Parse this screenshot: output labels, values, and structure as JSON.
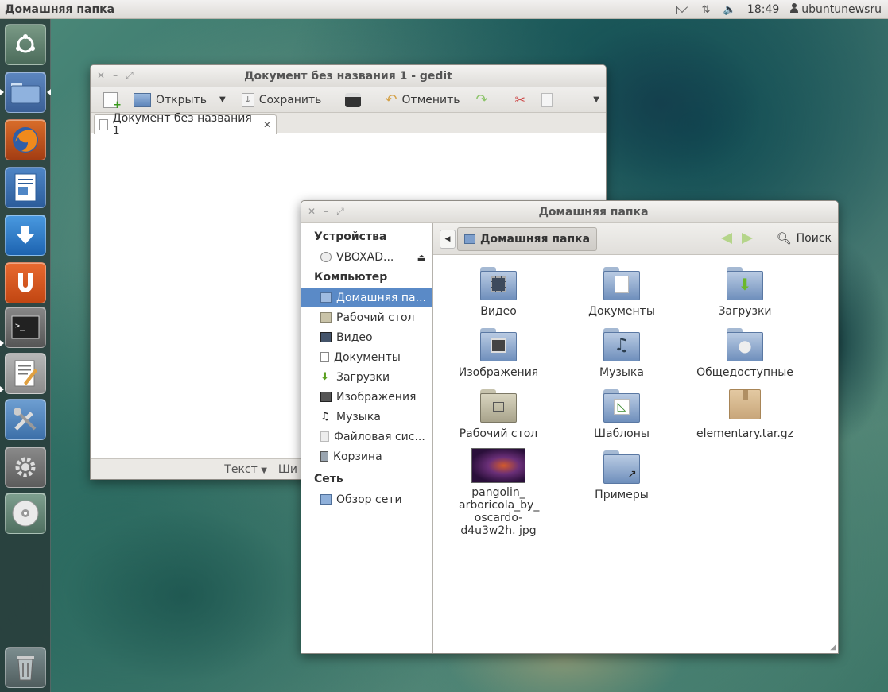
{
  "top_panel": {
    "title": "Домашняя папка",
    "clock": "18:49",
    "user": "ubuntunewsru"
  },
  "launcher": {
    "items": [
      "ubuntu-dash",
      "files",
      "firefox",
      "libreoffice-writer",
      "update-manager",
      "ubuntu-one",
      "terminal",
      "text-editor",
      "system-tools",
      "settings",
      "dvd",
      "trash"
    ]
  },
  "gedit": {
    "title": "Документ без названия 1 - gedit",
    "toolbar": {
      "open": "Открыть",
      "save": "Сохранить",
      "undo": "Отменить"
    },
    "tab_label": "Документ без названия 1",
    "status_text_mode": "Текст",
    "status_tab_width": "Ши"
  },
  "file_manager": {
    "title": "Домашняя папка",
    "breadcrumb": "Домашняя папка",
    "search": "Поиск",
    "sidebar": {
      "devices_header": "Устройства",
      "device": "VBOXAD...",
      "computer_header": "Компьютер",
      "computer_items": [
        "Домашняя па...",
        "Рабочий стол",
        "Видео",
        "Документы",
        "Загрузки",
        "Изображения",
        "Музыка",
        "Файловая сис...",
        "Корзина"
      ],
      "network_header": "Сеть",
      "network_items": [
        "Обзор сети"
      ]
    },
    "items": [
      "Видео",
      "Документы",
      "Загрузки",
      "Изображения",
      "Музыка",
      "Общедоступные",
      "Рабочий стол",
      "Шаблоны",
      "elementary.tar.gz",
      "pangolin_ arboricola_by_ oscardo-d4u3w2h. jpg",
      "Примеры"
    ]
  },
  "colors": {
    "selection": "#5a8ac7",
    "folder": "#6f8fbc",
    "launcher_bg": "#283232"
  }
}
